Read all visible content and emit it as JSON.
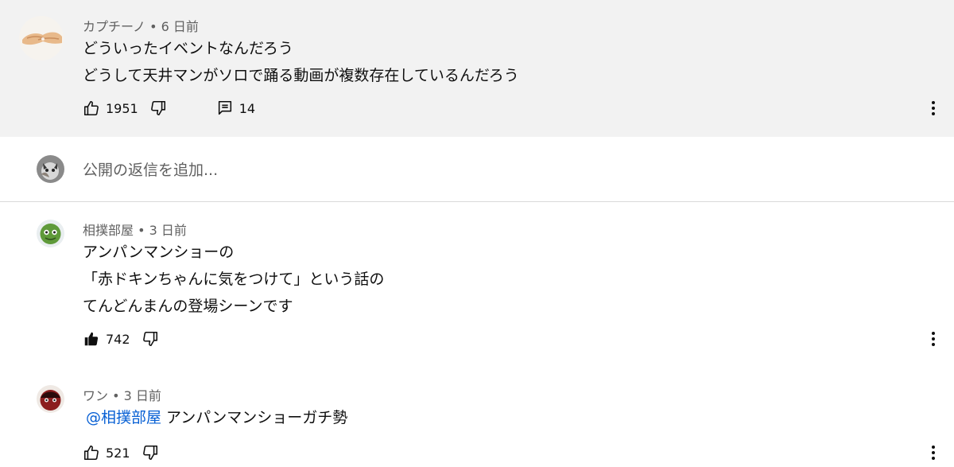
{
  "comments": [
    {
      "author": "カプチーノ",
      "time": "6 日前",
      "lines": [
        "どういったイベントなんだろう",
        "どうして天井マンがソロで踊る動画が複数存在しているんだろう"
      ],
      "likes": "1951",
      "replies": "14",
      "avatar_icon": "hands-avatar"
    },
    {
      "author": "相撲部屋",
      "time": "3 日前",
      "lines": [
        "アンパンマンショーの",
        "「赤ドキンちゃんに気をつけて」という話の",
        "てんどんまんの登場シーンです"
      ],
      "likes": "742",
      "avatar_icon": "green-character-avatar"
    },
    {
      "author": "ワン",
      "time": "3 日前",
      "mention": "@相撲部屋",
      "text": "アンパンマンショーガチ勢",
      "likes": "521",
      "avatar_icon": "red-character-avatar"
    }
  ],
  "reply_box": {
    "placeholder": "公開の返信を追加..."
  },
  "colors": {
    "highlight_bg": "#f2f2f2",
    "mention": "#065fd4",
    "meta": "#606060"
  }
}
